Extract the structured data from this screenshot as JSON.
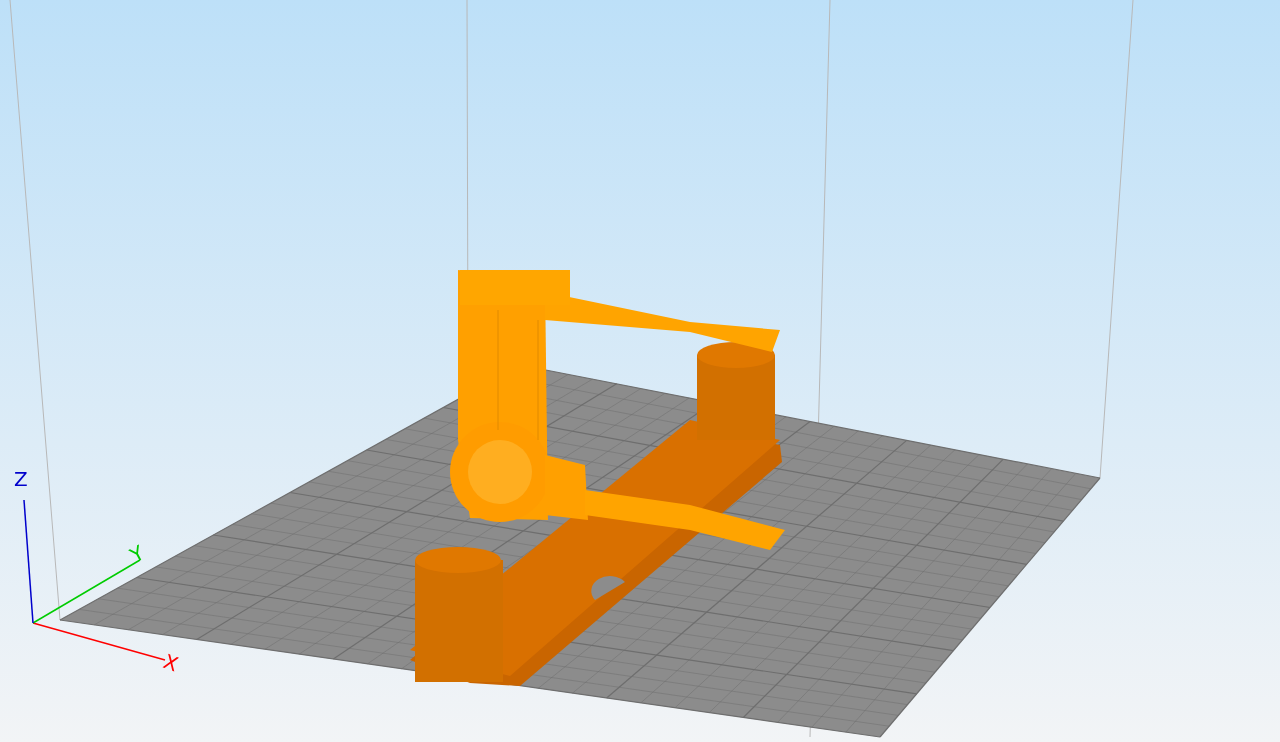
{
  "viewport": {
    "axes": [
      {
        "label": "X",
        "color": "#ff0000"
      },
      {
        "label": "Y",
        "color": "#00cc00"
      },
      {
        "label": "Z",
        "color": "#0000cc"
      }
    ]
  }
}
